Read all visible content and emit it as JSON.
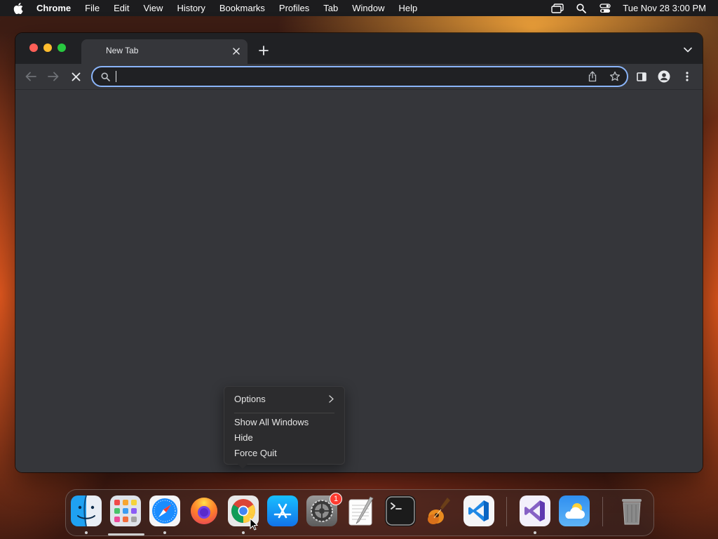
{
  "menubar": {
    "app_name": "Chrome",
    "items": [
      "File",
      "Edit",
      "View",
      "History",
      "Bookmarks",
      "Profiles",
      "Tab",
      "Window",
      "Help"
    ],
    "clock": "Tue Nov 28  3:00 PM"
  },
  "browser": {
    "tab_title": "New Tab",
    "omnibox_value": "",
    "omnibox_placeholder": ""
  },
  "context_menu": {
    "items": [
      "Options",
      "Show All Windows",
      "Hide",
      "Force Quit"
    ]
  },
  "dock": {
    "apps": [
      {
        "name": "finder-icon",
        "running": true
      },
      {
        "name": "launchpad-icon",
        "running": false
      },
      {
        "name": "safari-icon",
        "running": true
      },
      {
        "name": "firefox-icon",
        "running": false
      },
      {
        "name": "chrome-icon",
        "running": true
      },
      {
        "name": "app-store-icon",
        "running": false
      },
      {
        "name": "system-settings-icon",
        "running": false,
        "badge": "1"
      },
      {
        "name": "textedit-icon",
        "running": false
      },
      {
        "name": "terminal-icon",
        "running": false
      },
      {
        "name": "garageband-icon",
        "running": false
      },
      {
        "name": "vscode-icon",
        "running": false
      },
      {
        "name": "visual-studio-icon",
        "running": true
      },
      {
        "name": "weather-icon",
        "running": false
      },
      {
        "name": "trash-icon",
        "running": false
      }
    ]
  },
  "colors": {
    "accent": "#8ab4f8",
    "window_bg": "#35363a",
    "tabstrip_bg": "#202124",
    "badge": "#ff3b30"
  }
}
